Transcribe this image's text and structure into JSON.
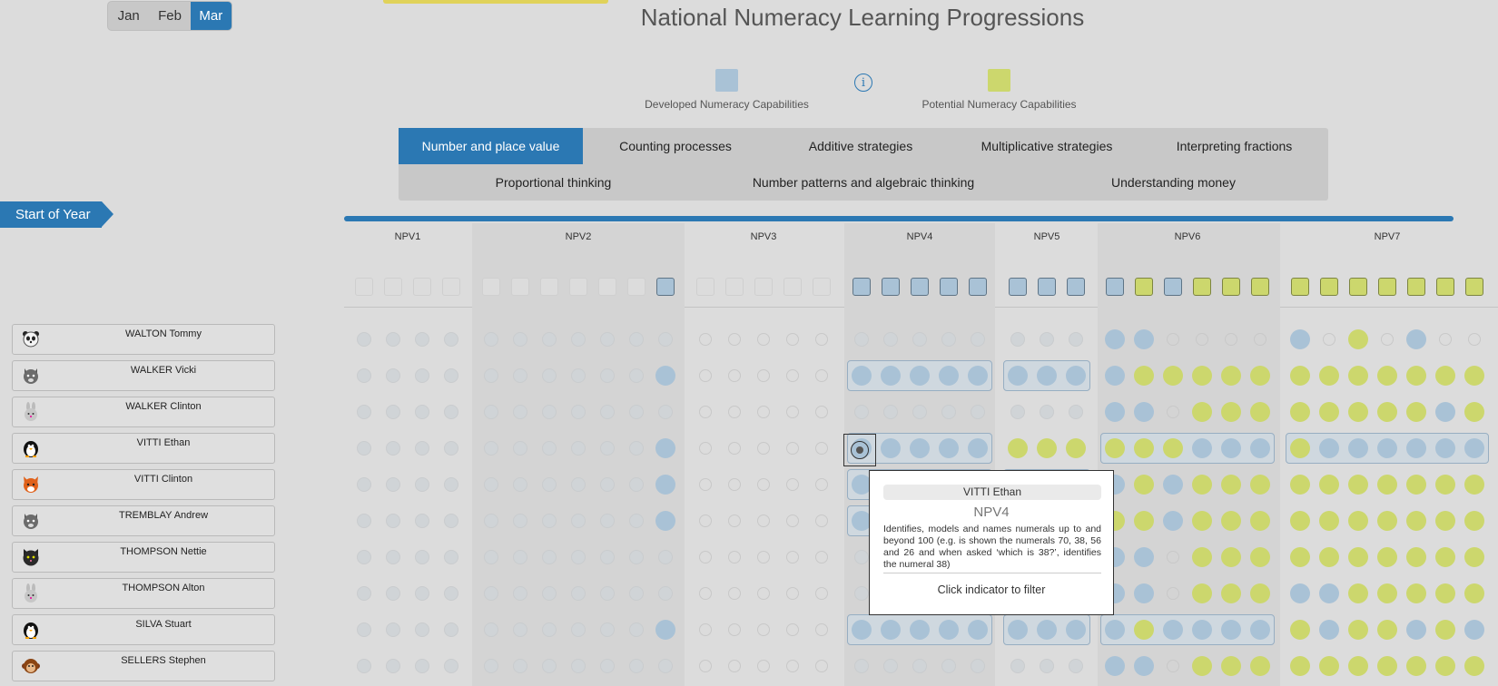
{
  "months": {
    "items": [
      {
        "label": "Jan",
        "active": false
      },
      {
        "label": "Feb",
        "active": false
      },
      {
        "label": "Mar",
        "active": true
      }
    ]
  },
  "title": "National Numeracy Learning Progressions",
  "legend": {
    "developed": {
      "label": "Developed Numeracy Capabilities",
      "color": "#a9c2d6"
    },
    "info_icon": "info-icon",
    "potential": {
      "label": "Potential Numeracy Capabilities",
      "color": "#ccd76d"
    }
  },
  "tabs": [
    {
      "label": "Number and place value",
      "active": true
    },
    {
      "label": "Counting processes",
      "active": false
    },
    {
      "label": "Additive strategies",
      "active": false
    },
    {
      "label": "Multiplicative strategies",
      "active": false
    },
    {
      "label": "Interpreting fractions",
      "active": false
    },
    {
      "label": "Proportional thinking",
      "active": false
    },
    {
      "label": "Number patterns and algebraic thinking",
      "active": false
    },
    {
      "label": "Understanding money",
      "active": false
    }
  ],
  "timeline_label": "Start of Year",
  "colors": {
    "accent": "#2b78b3",
    "developed": "#a9c2d6",
    "potential": "#ccd76d"
  },
  "levels": [
    {
      "label": "NPV1",
      "count": 4,
      "header": "eeee"
    },
    {
      "label": "NPV2",
      "count": 7,
      "header": "eeeeeeb"
    },
    {
      "label": "NPV3",
      "count": 5,
      "header": "eeeee"
    },
    {
      "label": "NPV4",
      "count": 5,
      "header": "bbbbb"
    },
    {
      "label": "NPV5",
      "count": 3,
      "header": "bbb"
    },
    {
      "label": "NPV6",
      "count": 6,
      "header": "bybyyy"
    },
    {
      "label": "NPV7",
      "count": 7,
      "header": "yyyyyyy"
    }
  ],
  "students": [
    {
      "name": "WALTON Tommy",
      "avatar": "panda-avatar",
      "marks": "gggg ggggggg eeeee ggggg ggg bbeeee beyebee"
    },
    {
      "name": "WALKER Vicki",
      "avatar": "wolf-avatar",
      "marks": "gggg ggggggb eeeee BBBBB BBB byyyyy yyyyyyy"
    },
    {
      "name": "WALKER Clinton",
      "avatar": "rabbit-avatar",
      "marks": "gggg ggggggg eeeee ggggg ggg bbeyyy yyyyyby"
    },
    {
      "name": "VITTI Ethan",
      "avatar": "penguin-avatar",
      "marks": "gggg ggggggb eeeee BBBBB yyy YYYBBB YBBBBBB"
    },
    {
      "name": "VITTI Clinton",
      "avatar": "fox-avatar",
      "marks": "gggg ggggggb eeeee BBBBB BBB bybyyy yyyyyyy"
    },
    {
      "name": "TREMBLAY Andrew",
      "avatar": "wolf-avatar",
      "marks": "gggg ggggggb eeeee BBBBB BBB yybyyy yyyyyyy"
    },
    {
      "name": "THOMPSON Nettie",
      "avatar": "cat-avatar",
      "marks": "gggg ggggggg eeeee ggggg ggg bbeyyy yyyyyyy"
    },
    {
      "name": "THOMPSON Alton",
      "avatar": "rabbit-avatar",
      "marks": "gggg ggggggg eeeee ggggg ggg bbeyyy bbyyyyy"
    },
    {
      "name": "SILVA Stuart",
      "avatar": "penguin-avatar",
      "marks": "gggg ggggggb eeeee BBBBB BBB BYBBBB ybyybyb"
    },
    {
      "name": "SELLERS Stephen",
      "avatar": "monkey-avatar",
      "marks": "gggg ggggggg eeeee ggggg ggg bbeyyy yyyyyyy"
    }
  ],
  "tooltip": {
    "student": "VITTI Ethan",
    "code": "NPV4",
    "description": "Identifies, models and names numerals up to and beyond 100 (e.g. is shown the numerals 70, 38, 56 and 26 and when asked ‘which is 38?’, identifies the numeral 38)",
    "action": "Click indicator to filter"
  }
}
